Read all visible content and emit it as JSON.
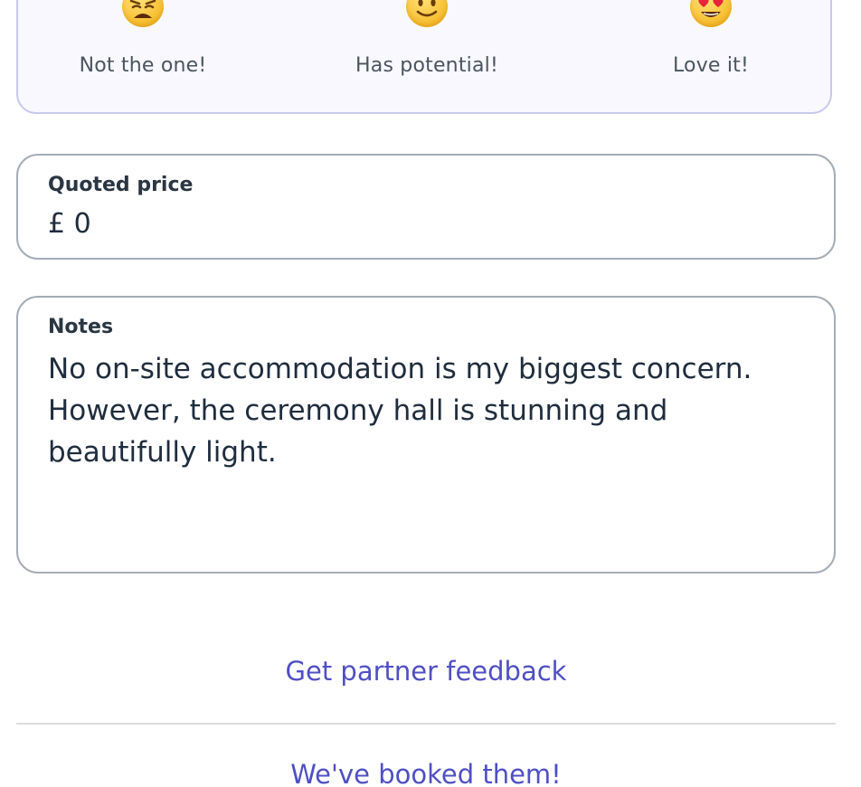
{
  "rating": {
    "options": [
      {
        "label": "Not the one!",
        "icon": "weary-face-icon"
      },
      {
        "label": "Has potential!",
        "icon": "slightly-smiling-face-icon"
      },
      {
        "label": "Love it!",
        "icon": "heart-eyes-face-icon"
      }
    ]
  },
  "price": {
    "label": "Quoted price",
    "value": "£ 0"
  },
  "notes": {
    "label": "Notes",
    "value": "No on-site accommodation is my biggest concern. However, the ceremony hall is stunning and beautifully light."
  },
  "actions": {
    "partner_feedback": "Get partner feedback",
    "booked": "We've booked them!"
  },
  "colors": {
    "accent": "#4f4fc4",
    "card_border": "#c8c8ee",
    "card_background": "#f8f8fe",
    "field_border": "#a5adb5",
    "divider": "#dcdcdc"
  }
}
